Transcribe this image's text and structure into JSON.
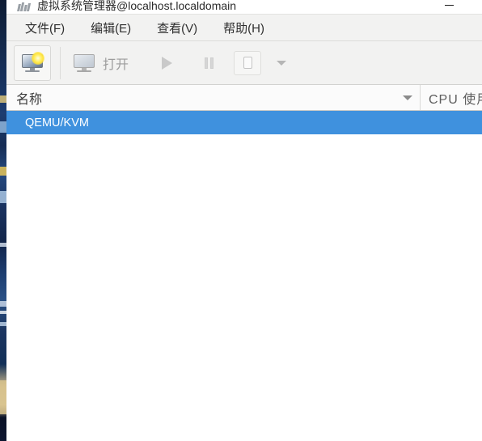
{
  "window": {
    "title": "虚拟系统管理器@localhost.localdomain",
    "icon": "virt-manager-icon",
    "minimize_label": "—"
  },
  "menubar": {
    "items": [
      {
        "label": "文件(F)"
      },
      {
        "label": "编辑(E)"
      },
      {
        "label": "查看(V)"
      },
      {
        "label": "帮助(H)"
      }
    ]
  },
  "toolbar": {
    "new_vm": {
      "label": "",
      "icon": "new-virtual-machine-icon",
      "enabled": true
    },
    "open": {
      "label": "打开",
      "icon": "monitor-icon",
      "enabled": false
    },
    "run": {
      "label": "",
      "icon": "play-icon",
      "enabled": false
    },
    "pause": {
      "label": "",
      "icon": "pause-icon",
      "enabled": false
    },
    "shutdown": {
      "label": "",
      "icon": "shutdown-icon",
      "enabled": false
    },
    "more": {
      "label": "",
      "icon": "chevron-down-icon",
      "enabled": true
    }
  },
  "list": {
    "columns": [
      {
        "key": "name",
        "label": "名称",
        "sort": "descending",
        "sort_icon": "triangle-down-icon"
      },
      {
        "key": "cpu",
        "label": "CPU 使用"
      }
    ],
    "rows": [
      {
        "name": "QEMU/KVM",
        "cpu": "",
        "selected": true
      }
    ]
  },
  "colors": {
    "selection_blue": "#3f91de",
    "toolbar_bg": "#f2f2f1",
    "window_bg": "#ffffff",
    "header_bg": "#fbfbfb",
    "disabled_text": "#9c9c9c"
  }
}
